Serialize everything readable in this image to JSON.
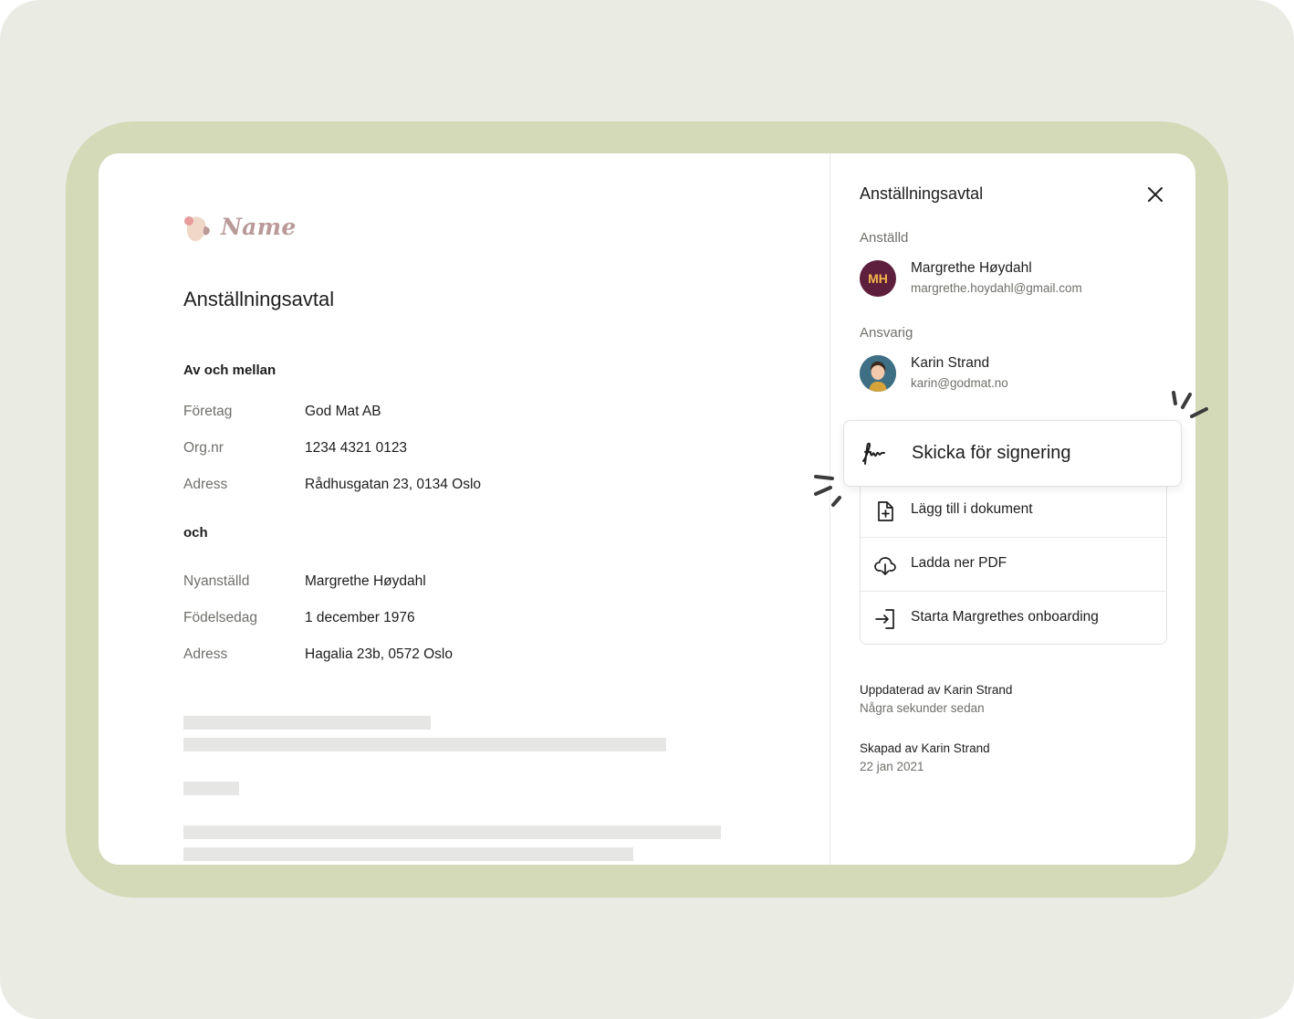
{
  "logo": {
    "text": "Name"
  },
  "document": {
    "title": "Anställningsavtal",
    "section_between": "Av och mellan",
    "company_rows": [
      {
        "key": "Företag",
        "value": "God Mat AB"
      },
      {
        "key": "Org.nr",
        "value": "1234 4321 0123"
      },
      {
        "key": "Adress",
        "value": "Rådhusgatan 23, 0134 Oslo"
      }
    ],
    "section_and": "och",
    "employee_rows": [
      {
        "key": "Nyanställd",
        "value": "Margrethe Høydahl"
      },
      {
        "key": "Födelsedag",
        "value": "1 december 1976"
      },
      {
        "key": "Adress",
        "value": "Hagalia 23b, 0572 Oslo"
      }
    ]
  },
  "panel": {
    "title": "Anställningsavtal",
    "employee_label": "Anställd",
    "employee": {
      "initials": "MH",
      "name": "Margrethe Høydahl",
      "email": "margrethe.hoydahl@gmail.com"
    },
    "responsible_label": "Ansvarig",
    "responsible": {
      "name": "Karin Strand",
      "email": "karin@godmat.no"
    },
    "primary_action": "Skicka för signering",
    "actions": [
      {
        "label": "Lägg till i dokument",
        "icon": "file-plus-icon"
      },
      {
        "label": "Ladda ner PDF",
        "icon": "cloud-download-icon"
      },
      {
        "label": "Starta Margrethes onboarding",
        "icon": "login-arrow-icon"
      }
    ],
    "updated_by": "Uppdaterad av Karin Strand",
    "updated_when": "Några sekunder sedan",
    "created_by": "Skapad av Karin Strand",
    "created_when": "22 jan 2021"
  },
  "colors": {
    "background": "#eaebe3",
    "frame": "#d4dab8",
    "avatar_bg": "#5e1f3c",
    "avatar_text": "#f5b54c",
    "logo": "#b99a99"
  }
}
